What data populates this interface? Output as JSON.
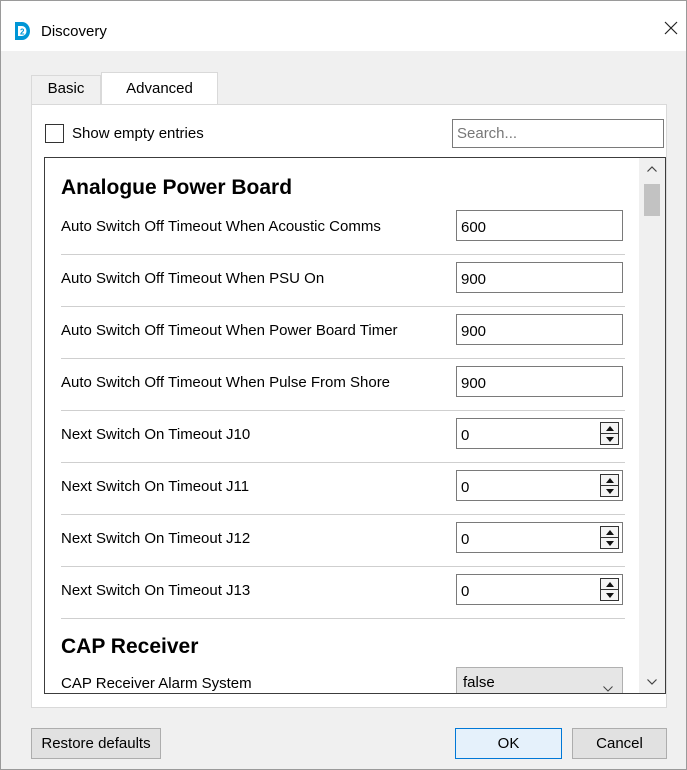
{
  "window": {
    "title": "Discovery",
    "icon": "discovery-app-icon",
    "close_icon": "close-icon",
    "accent_color": "#0096d6"
  },
  "tabs": [
    {
      "label": "Basic",
      "selected": false
    },
    {
      "label": "Advanced",
      "selected": true
    }
  ],
  "filter": {
    "show_empty_label": "Show empty entries",
    "show_empty_checked": false,
    "search_placeholder": "Search..."
  },
  "groups": [
    {
      "title": "Analogue Power Board",
      "rows": [
        {
          "label": "Auto Switch Off Timeout When Acoustic Comms",
          "value": "600",
          "control": "text"
        },
        {
          "label": "Auto Switch Off Timeout When PSU On",
          "value": "900",
          "control": "text"
        },
        {
          "label": "Auto Switch Off Timeout When Power Board Timer",
          "value": "900",
          "control": "text"
        },
        {
          "label": "Auto Switch Off Timeout When Pulse From Shore",
          "value": "900",
          "control": "text"
        },
        {
          "label": "Next Switch On Timeout J10",
          "value": "0",
          "control": "spinner"
        },
        {
          "label": "Next Switch On Timeout J11",
          "value": "0",
          "control": "spinner"
        },
        {
          "label": "Next Switch On Timeout J12",
          "value": "0",
          "control": "spinner"
        },
        {
          "label": "Next Switch On Timeout J13",
          "value": "0",
          "control": "spinner"
        }
      ]
    },
    {
      "title": "CAP Receiver",
      "rows": [
        {
          "label": "CAP Receiver Alarm System",
          "value": "false",
          "control": "select"
        }
      ]
    }
  ],
  "buttons": {
    "restore": "Restore defaults",
    "ok": "OK",
    "cancel": "Cancel"
  },
  "icons": {
    "spin_up": "spin-up-icon",
    "spin_down": "spin-down-icon",
    "chevron_down": "chevron-down-icon",
    "scroll_up": "scroll-up-arrow-icon",
    "scroll_down": "scroll-down-arrow-icon"
  }
}
